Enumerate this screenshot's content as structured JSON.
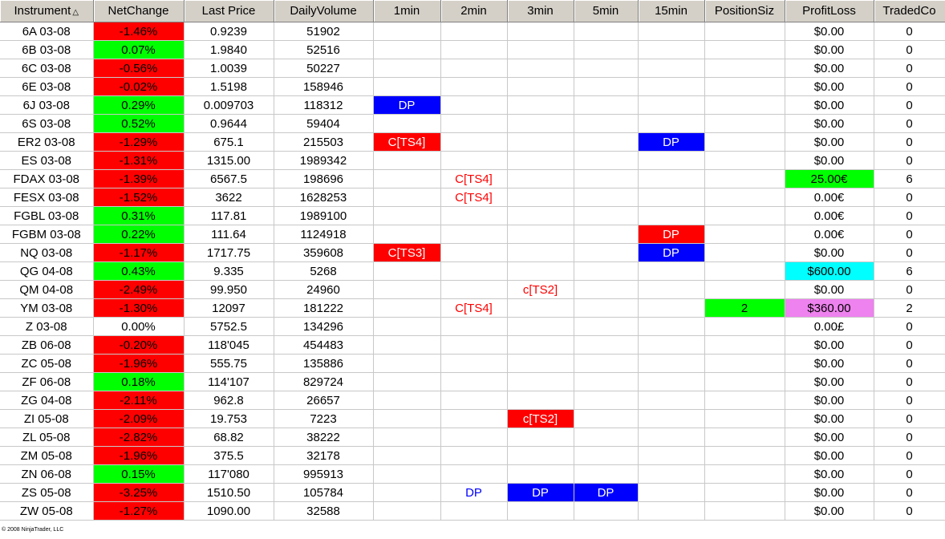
{
  "columns": [
    "Instrument",
    "NetChange",
    "Last Price",
    "DailyVolume",
    "1min",
    "2min",
    "3min",
    "5min",
    "15min",
    "PositionSiz",
    "ProfitLoss",
    "TradedCo"
  ],
  "sort_icon": "sort-ascending-icon",
  "colors": {
    "red": "#ff0000",
    "green": "#00ff00",
    "blue": "#0000ff",
    "cyan": "#00ffff",
    "violet": "#ee82ee",
    "white": "#ffffff",
    "red_text": "#ff0000",
    "blue_text": "#0000ff"
  },
  "rows": [
    {
      "instrument": "6A 03-08",
      "net_change": "-1.46%",
      "net_bg": "red",
      "last_price": "0.9239",
      "volume": "51902",
      "profit_loss": "$0.00",
      "traded": "0"
    },
    {
      "instrument": "6B 03-08",
      "net_change": "0.07%",
      "net_bg": "green",
      "last_price": "1.9840",
      "volume": "52516",
      "profit_loss": "$0.00",
      "traded": "0"
    },
    {
      "instrument": "6C 03-08",
      "net_change": "-0.56%",
      "net_bg": "red",
      "last_price": "1.0039",
      "volume": "50227",
      "profit_loss": "$0.00",
      "traded": "0"
    },
    {
      "instrument": "6E 03-08",
      "net_change": "-0.02%",
      "net_bg": "red",
      "last_price": "1.5198",
      "volume": "158946",
      "profit_loss": "$0.00",
      "traded": "0"
    },
    {
      "instrument": "6J 03-08",
      "net_change": "0.29%",
      "net_bg": "green",
      "last_price": "0.009703",
      "volume": "118312",
      "m1": {
        "text": "DP",
        "bg": "blue",
        "fg": "white"
      },
      "profit_loss": "$0.00",
      "traded": "0"
    },
    {
      "instrument": "6S 03-08",
      "net_change": "0.52%",
      "net_bg": "green",
      "last_price": "0.9644",
      "volume": "59404",
      "profit_loss": "$0.00",
      "traded": "0"
    },
    {
      "instrument": "ER2 03-08",
      "net_change": "-1.29%",
      "net_bg": "red",
      "last_price": "675.1",
      "volume": "215503",
      "m1": {
        "text": "C[TS4]",
        "bg": "red",
        "fg": "white"
      },
      "m15": {
        "text": "DP",
        "bg": "blue",
        "fg": "white"
      },
      "profit_loss": "$0.00",
      "traded": "0"
    },
    {
      "instrument": "ES 03-08",
      "net_change": "-1.31%",
      "net_bg": "red",
      "last_price": "1315.00",
      "volume": "1989342",
      "profit_loss": "$0.00",
      "traded": "0"
    },
    {
      "instrument": "FDAX 03-08",
      "net_change": "-1.39%",
      "net_bg": "red",
      "last_price": "6567.5",
      "volume": "198696",
      "m2": {
        "text": "C[TS4]",
        "fg": "red_text"
      },
      "profit_loss": "25.00€",
      "pl_bg": "green",
      "traded": "6"
    },
    {
      "instrument": "FESX 03-08",
      "net_change": "-1.52%",
      "net_bg": "red",
      "last_price": "3622",
      "volume": "1628253",
      "m2": {
        "text": "C[TS4]",
        "fg": "red_text"
      },
      "profit_loss": "0.00€",
      "traded": "0"
    },
    {
      "instrument": "FGBL 03-08",
      "net_change": "0.31%",
      "net_bg": "green",
      "last_price": "117.81",
      "volume": "1989100",
      "profit_loss": "0.00€",
      "traded": "0"
    },
    {
      "instrument": "FGBM 03-08",
      "net_change": "0.22%",
      "net_bg": "green",
      "last_price": "111.64",
      "volume": "1124918",
      "m15": {
        "text": "DP",
        "bg": "red",
        "fg": "white"
      },
      "profit_loss": "0.00€",
      "traded": "0"
    },
    {
      "instrument": "NQ 03-08",
      "net_change": "-1.17%",
      "net_bg": "red",
      "last_price": "1717.75",
      "volume": "359608",
      "m1": {
        "text": "C[TS3]",
        "bg": "red",
        "fg": "white"
      },
      "m15": {
        "text": "DP",
        "bg": "blue",
        "fg": "white"
      },
      "profit_loss": "$0.00",
      "traded": "0"
    },
    {
      "instrument": "QG 04-08",
      "net_change": "0.43%",
      "net_bg": "green",
      "last_price": "9.335",
      "volume": "5268",
      "profit_loss": "$600.00",
      "pl_bg": "cyan",
      "traded": "6"
    },
    {
      "instrument": "QM 04-08",
      "net_change": "-2.49%",
      "net_bg": "red",
      "last_price": "99.950",
      "volume": "24960",
      "m3": {
        "text": "c[TS2]",
        "fg": "red_text"
      },
      "profit_loss": "$0.00",
      "traded": "0"
    },
    {
      "instrument": "YM 03-08",
      "net_change": "-1.30%",
      "net_bg": "red",
      "last_price": "12097",
      "volume": "181222",
      "m2": {
        "text": "C[TS4]",
        "fg": "red_text"
      },
      "position": "2",
      "pos_bg": "green",
      "profit_loss": "$360.00",
      "pl_bg": "violet",
      "traded": "2"
    },
    {
      "instrument": "Z 03-08",
      "net_change": "0.00%",
      "net_bg": "white",
      "last_price": "5752.5",
      "volume": "134296",
      "profit_loss": "0.00£",
      "traded": "0"
    },
    {
      "instrument": "ZB 06-08",
      "net_change": "-0.20%",
      "net_bg": "red",
      "last_price": "118'045",
      "volume": "454483",
      "profit_loss": "$0.00",
      "traded": "0"
    },
    {
      "instrument": "ZC 05-08",
      "net_change": "-1.96%",
      "net_bg": "red",
      "last_price": "555.75",
      "volume": "135886",
      "profit_loss": "$0.00",
      "traded": "0"
    },
    {
      "instrument": "ZF 06-08",
      "net_change": "0.18%",
      "net_bg": "green",
      "last_price": "114'107",
      "volume": "829724",
      "profit_loss": "$0.00",
      "traded": "0"
    },
    {
      "instrument": "ZG 04-08",
      "net_change": "-2.11%",
      "net_bg": "red",
      "last_price": "962.8",
      "volume": "26657",
      "profit_loss": "$0.00",
      "traded": "0"
    },
    {
      "instrument": "ZI 05-08",
      "net_change": "-2.09%",
      "net_bg": "red",
      "last_price": "19.753",
      "volume": "7223",
      "m3": {
        "text": "c[TS2]",
        "bg": "red",
        "fg": "white"
      },
      "profit_loss": "$0.00",
      "traded": "0"
    },
    {
      "instrument": "ZL 05-08",
      "net_change": "-2.82%",
      "net_bg": "red",
      "last_price": "68.82",
      "volume": "38222",
      "profit_loss": "$0.00",
      "traded": "0"
    },
    {
      "instrument": "ZM 05-08",
      "net_change": "-1.96%",
      "net_bg": "red",
      "last_price": "375.5",
      "volume": "32178",
      "profit_loss": "$0.00",
      "traded": "0"
    },
    {
      "instrument": "ZN 06-08",
      "net_change": "0.15%",
      "net_bg": "green",
      "last_price": "117'080",
      "volume": "995913",
      "profit_loss": "$0.00",
      "traded": "0"
    },
    {
      "instrument": "ZS 05-08",
      "net_change": "-3.25%",
      "net_bg": "red",
      "last_price": "1510.50",
      "volume": "105784",
      "m2": {
        "text": "DP",
        "fg": "blue_text"
      },
      "m3": {
        "text": "DP",
        "bg": "blue",
        "fg": "white"
      },
      "m5": {
        "text": "DP",
        "bg": "blue",
        "fg": "white"
      },
      "profit_loss": "$0.00",
      "traded": "0"
    },
    {
      "instrument": "ZW 05-08",
      "net_change": "-1.27%",
      "net_bg": "red",
      "last_price": "1090.00",
      "volume": "32588",
      "profit_loss": "$0.00",
      "traded": "0"
    }
  ],
  "footer": "© 2008 NinjaTrader, LLC"
}
